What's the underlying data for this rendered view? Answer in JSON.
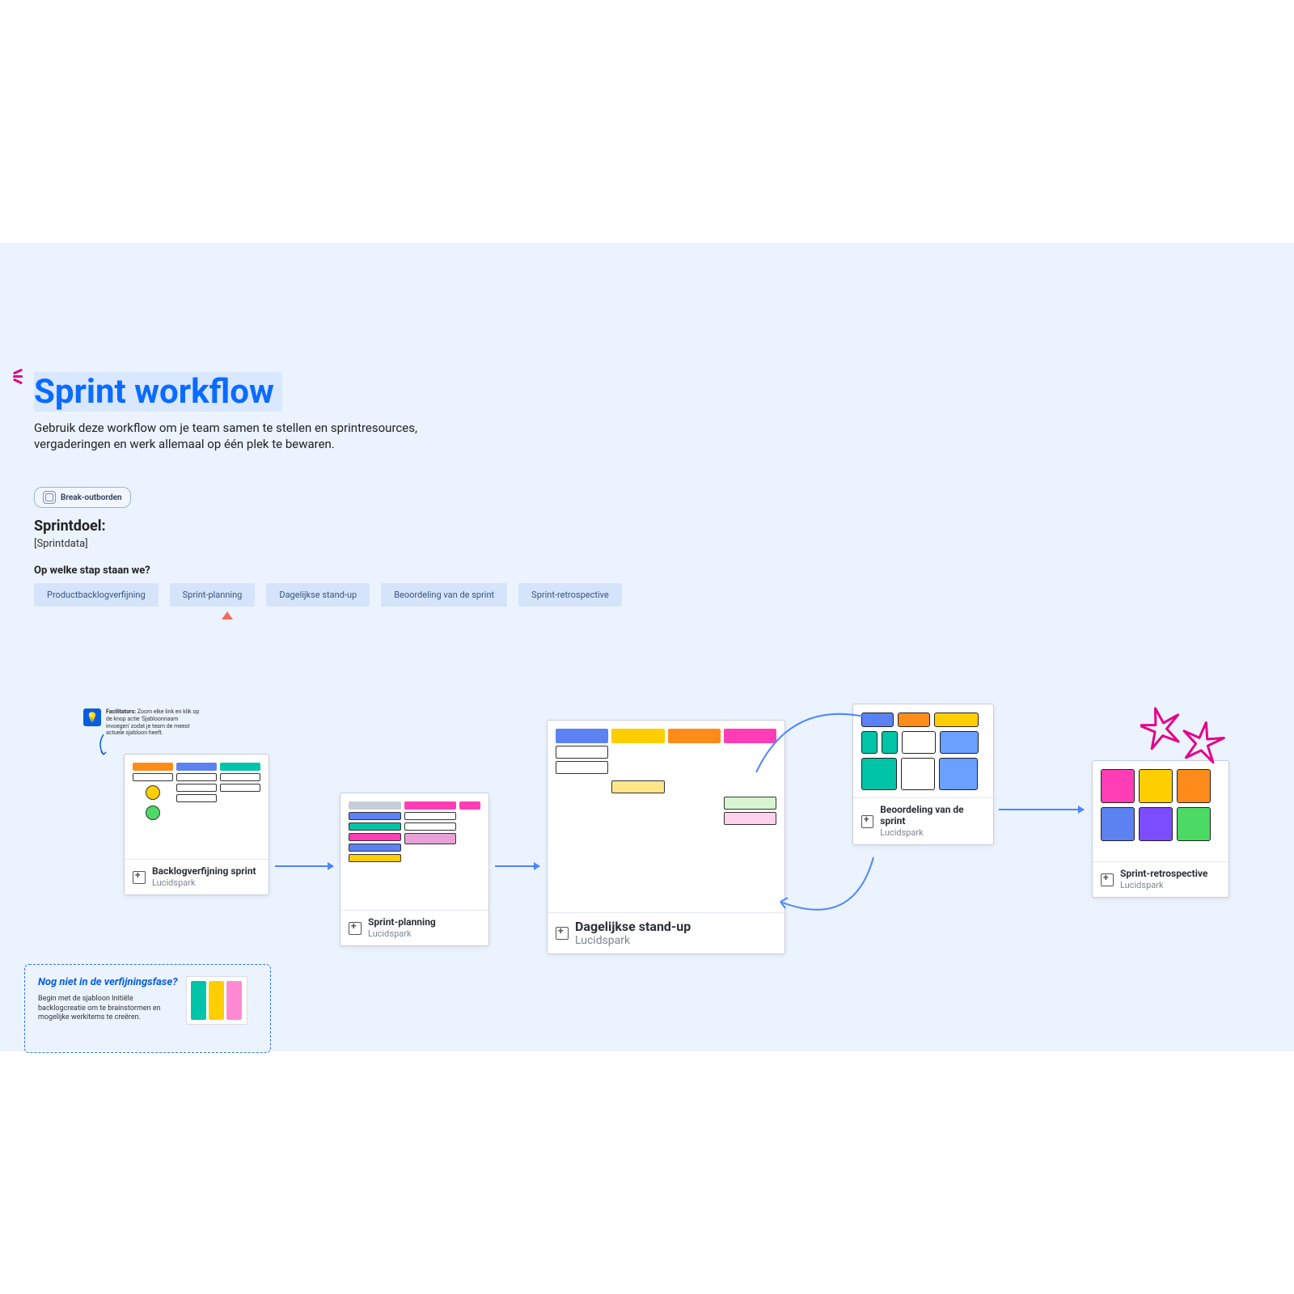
{
  "title": "Sprint workflow",
  "subtitle": "Gebruik deze workflow om je team samen te stellen en sprintresources, vergaderingen en werk allemaal op één plek te bewaren.",
  "breakout_label": "Break-outborden",
  "sprint_goal": {
    "heading": "Sprintdoel:",
    "value": "[Sprintdata]"
  },
  "steps": {
    "heading": "Op welke stap staan we?",
    "items": [
      "Productbacklogverfijning",
      "Sprint-planning",
      "Dagelijkse stand-up",
      "Beoordeling van de sprint",
      "Sprint-retrospective"
    ],
    "current_index": 1
  },
  "facilitator_note": {
    "bold": "Facilitators:",
    "text": "Zoom elke link en klik op de knop actie 'Sjabloonnaam invoegen' zodat je team de meest actuele sjabloon heeft."
  },
  "cards": {
    "backlog": {
      "name": "Backlogverfijning sprint",
      "vendor": "Lucidspark"
    },
    "planning": {
      "name": "Sprint-planning",
      "vendor": "Lucidspark"
    },
    "standup": {
      "name": "Dagelijkse stand-up",
      "vendor": "Lucidspark"
    },
    "review": {
      "name": "Beoordeling van de sprint",
      "vendor": "Lucidspark"
    },
    "retro": {
      "name": "Sprint-retrospective",
      "vendor": "Lucidspark"
    }
  },
  "side_box": {
    "title": "Nog niet in de verfijningsfase?",
    "body": "Begin met de sjabloon Initiële backlogcreatie om te brainstormen en mogelijke werkitems te creëren."
  },
  "colors": {
    "blue": "#5b82f0",
    "yellow": "#ffce00",
    "orange": "#ff8c1a",
    "teal": "#00c4a7",
    "pink": "#ff3eb5",
    "purple": "#7c4dff",
    "green": "#4cd964",
    "gray": "#c8ced6",
    "lgreen": "#d7f5d0"
  }
}
